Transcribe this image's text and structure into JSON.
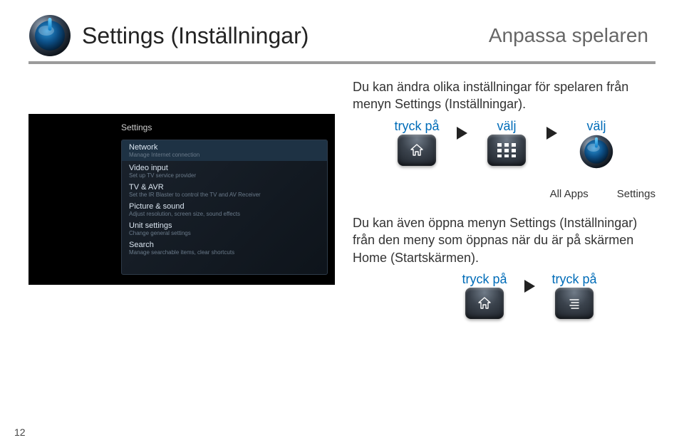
{
  "header": {
    "title": "Settings (Inställningar)",
    "subtitle": "Anpassa spelaren"
  },
  "intro_text": "Du kan ändra olika inställningar för spelaren från menyn Settings (Inställningar).",
  "actions1": {
    "press_label": "tryck på",
    "select_label_1": "välj",
    "select_label_2": "välj"
  },
  "captions": {
    "all_apps": "All Apps",
    "settings": "Settings"
  },
  "body2_text": "Du kan även öppna menyn Settings (Inställningar) från den meny som öppnas när du är på skärmen Home (Startskärmen).",
  "actions2": {
    "press_label_1": "tryck på",
    "press_label_2": "tryck på"
  },
  "screenshot": {
    "panel_title": "Settings",
    "items": [
      {
        "title": "Network",
        "sub": "Manage Internet connection"
      },
      {
        "title": "Video input",
        "sub": "Set up TV service provider"
      },
      {
        "title": "TV & AVR",
        "sub": "Set the IR Blaster to control the TV and AV Receiver"
      },
      {
        "title": "Picture & sound",
        "sub": "Adjust resolution, screen size, sound effects"
      },
      {
        "title": "Unit settings",
        "sub": "Change general settings"
      },
      {
        "title": "Search",
        "sub": "Manage searchable items, clear shortcuts"
      }
    ]
  },
  "page_number": "12"
}
